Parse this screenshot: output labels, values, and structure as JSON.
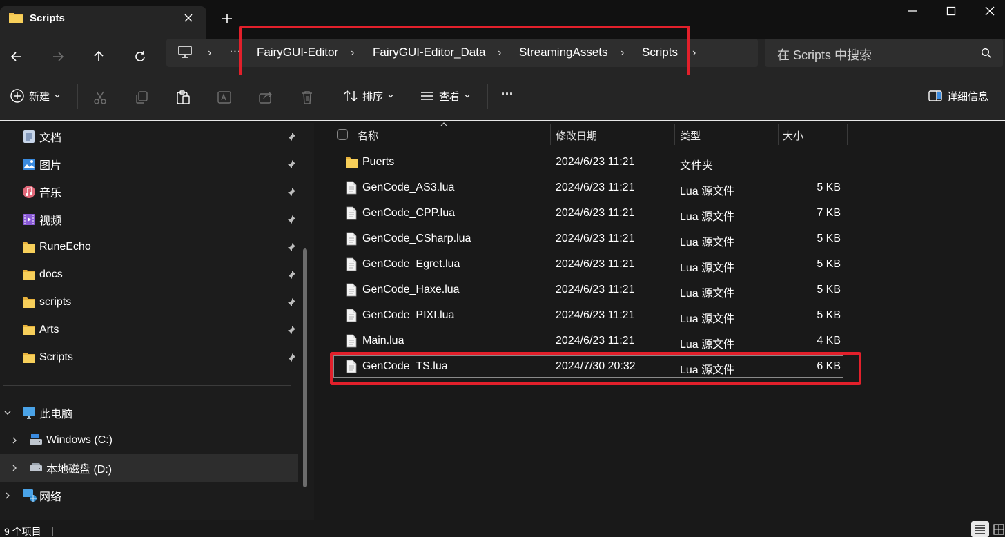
{
  "window": {
    "tab_title": "Scripts",
    "new_tab_symbol": "+"
  },
  "address": {
    "overflow": "···",
    "breadcrumbs": [
      "FairyGUI-Editor",
      "FairyGUI-Editor_Data",
      "StreamingAssets",
      "Scripts"
    ],
    "separator": "›",
    "search_placeholder": "在 Scripts 中搜索"
  },
  "toolbar": {
    "new_label": "新建",
    "sort_label": "排序",
    "view_label": "查看",
    "more_label": "···",
    "details_label": "详细信息"
  },
  "nav": {
    "quick_access": [
      {
        "label": "文档",
        "icon": "documents-icon",
        "pinned": true
      },
      {
        "label": "图片",
        "icon": "pictures-icon",
        "pinned": true
      },
      {
        "label": "音乐",
        "icon": "music-icon",
        "pinned": true
      },
      {
        "label": "视频",
        "icon": "videos-icon",
        "pinned": true
      },
      {
        "label": "RuneEcho",
        "icon": "folder-icon",
        "pinned": true
      },
      {
        "label": "docs",
        "icon": "folder-icon",
        "pinned": true
      },
      {
        "label": "scripts",
        "icon": "folder-icon",
        "pinned": true
      },
      {
        "label": "Arts",
        "icon": "folder-icon",
        "pinned": true
      },
      {
        "label": "Scripts",
        "icon": "folder-icon",
        "pinned": true
      }
    ],
    "this_pc": "此电脑",
    "drive_c": "Windows (C:)",
    "drive_d": "本地磁盘 (D:)",
    "network": "网络"
  },
  "columns": {
    "name": "名称",
    "date": "修改日期",
    "type": "类型",
    "size": "大小"
  },
  "files": [
    {
      "name": "Puerts",
      "date": "2024/6/23 11:21",
      "type": "文件夹",
      "size": "",
      "kind": "folder"
    },
    {
      "name": "GenCode_AS3.lua",
      "date": "2024/6/23 11:21",
      "type": "Lua 源文件",
      "size": "5 KB",
      "kind": "file"
    },
    {
      "name": "GenCode_CPP.lua",
      "date": "2024/6/23 11:21",
      "type": "Lua 源文件",
      "size": "7 KB",
      "kind": "file"
    },
    {
      "name": "GenCode_CSharp.lua",
      "date": "2024/6/23 11:21",
      "type": "Lua 源文件",
      "size": "5 KB",
      "kind": "file"
    },
    {
      "name": "GenCode_Egret.lua",
      "date": "2024/6/23 11:21",
      "type": "Lua 源文件",
      "size": "5 KB",
      "kind": "file"
    },
    {
      "name": "GenCode_Haxe.lua",
      "date": "2024/6/23 11:21",
      "type": "Lua 源文件",
      "size": "5 KB",
      "kind": "file"
    },
    {
      "name": "GenCode_PIXI.lua",
      "date": "2024/6/23 11:21",
      "type": "Lua 源文件",
      "size": "5 KB",
      "kind": "file"
    },
    {
      "name": "Main.lua",
      "date": "2024/6/23 11:21",
      "type": "Lua 源文件",
      "size": "4 KB",
      "kind": "file"
    },
    {
      "name": "GenCode_TS.lua",
      "date": "2024/7/30 20:32",
      "type": "Lua 源文件",
      "size": "6 KB",
      "kind": "file"
    }
  ],
  "status": {
    "item_count": "9 个项目",
    "separator": "|"
  },
  "colors": {
    "highlight": "#e2202b",
    "folder": "#f2c14e",
    "background": "#191919"
  }
}
